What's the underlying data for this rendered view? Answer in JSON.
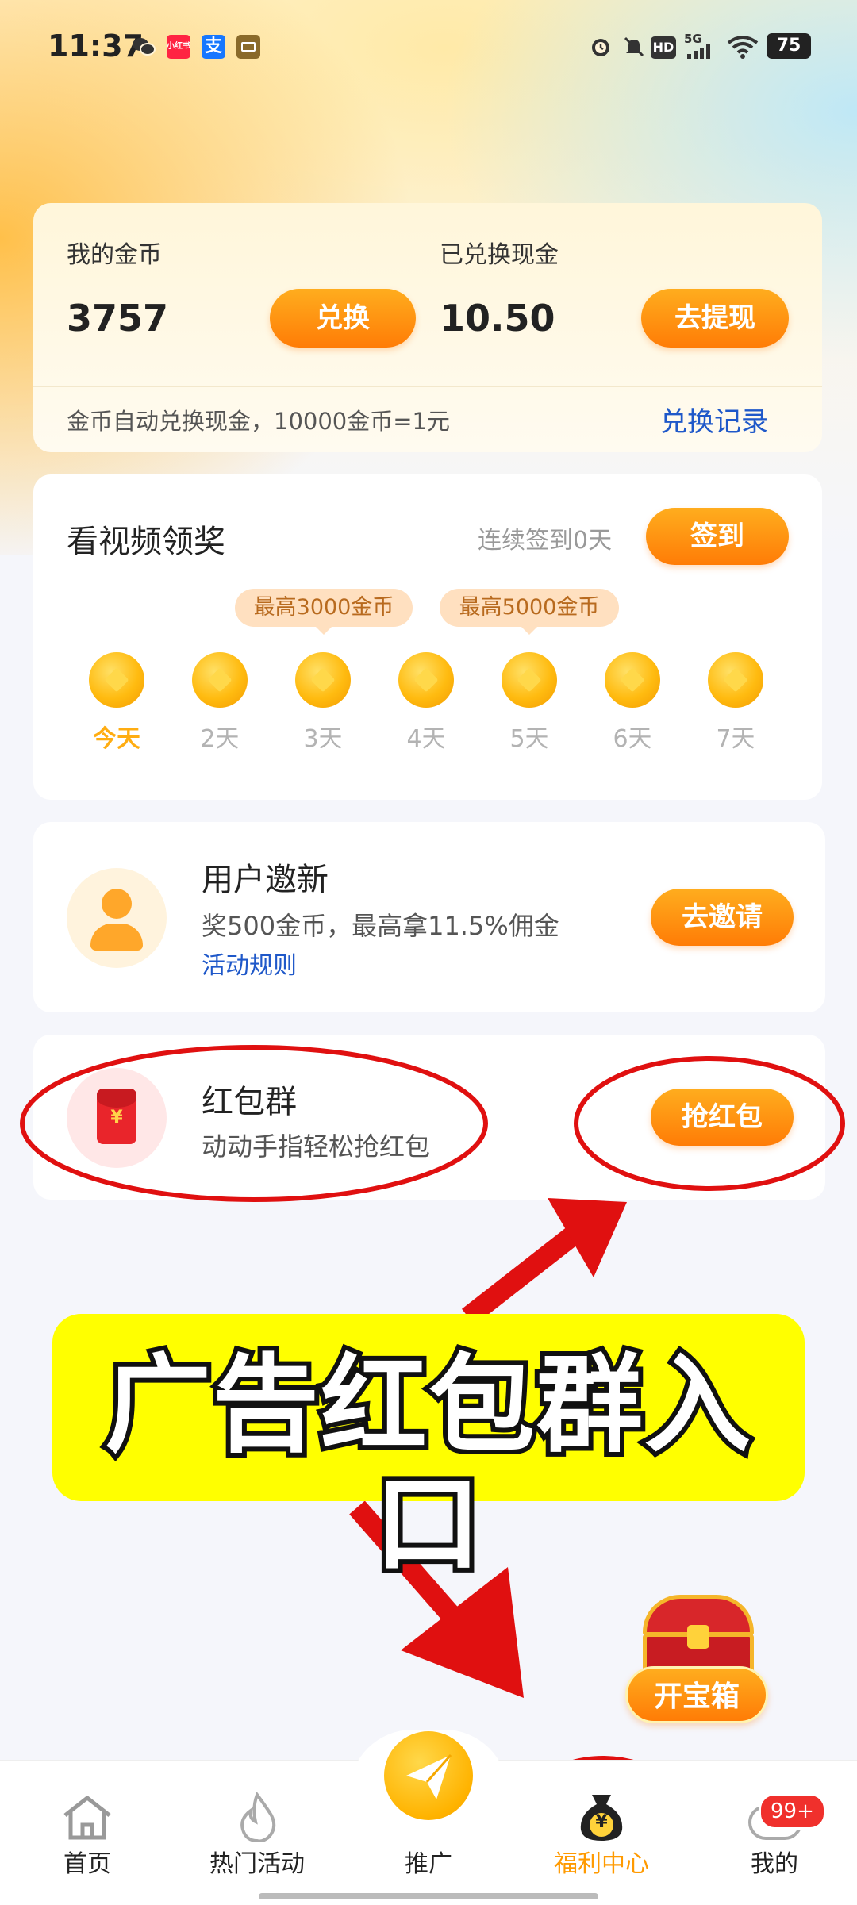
{
  "status_bar": {
    "time": "11:37",
    "app_icons": [
      "wechat-icon",
      "xiaohongshu-icon",
      "alipay-icon",
      "wallet-icon"
    ],
    "xiaohongshu_text": "小红书",
    "alipay_text": "支",
    "network": "5G",
    "hd": "HD",
    "battery": "75"
  },
  "wallet": {
    "coins_label": "我的金币",
    "coins_value": "3757",
    "exchange_button": "兑换",
    "cash_label": "已兑换现金",
    "cash_value": "10.50",
    "withdraw_button": "去提现",
    "note": "金币自动兑换现金，10000金币=1元",
    "records_link": "兑换记录"
  },
  "checkin": {
    "title": "看视频领奖",
    "streak": "连续签到0天",
    "checkin_button": "签到",
    "bubbles": [
      "最高3000金币",
      "最高5000金币"
    ],
    "days": [
      "今天",
      "2天",
      "3天",
      "4天",
      "5天",
      "6天",
      "7天"
    ]
  },
  "invite": {
    "title": "用户邀新",
    "desc": "奖500金币，最高拿11.5%佣金",
    "rules_link": "活动规则",
    "button": "去邀请"
  },
  "redpacket": {
    "title": "红包群",
    "desc": "动动手指轻松抢红包",
    "button": "抢红包",
    "icon_symbol": "¥"
  },
  "annotation": {
    "banner_text": "广告红包群入口"
  },
  "treasure": {
    "label": "开宝箱"
  },
  "tabbar": {
    "items": [
      {
        "label": "首页",
        "icon": "home-icon"
      },
      {
        "label": "热门活动",
        "icon": "flame-icon"
      },
      {
        "label": "推广",
        "icon": "paper-plane-icon"
      },
      {
        "label": "福利中心",
        "icon": "money-bag-icon"
      },
      {
        "label": "我的",
        "icon": "profile-icon"
      }
    ],
    "badge": "99+",
    "bag_symbol": "¥"
  },
  "colors": {
    "accent_orange": "#ff8a0c",
    "link_blue": "#1f58c9",
    "annotation_red": "#e01010",
    "banner_yellow": "#ffff00"
  }
}
